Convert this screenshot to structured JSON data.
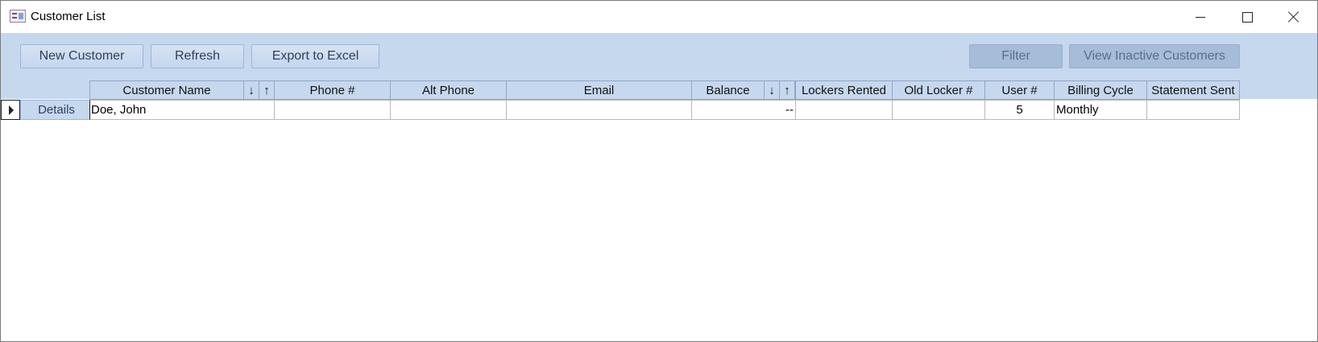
{
  "window": {
    "title": "Customer List",
    "icon": "form-icon"
  },
  "toolbar": {
    "new_customer": "New Customer",
    "refresh": "Refresh",
    "export_excel": "Export to Excel",
    "filter": "Filter",
    "view_inactive": "View Inactive Customers"
  },
  "table": {
    "headers": {
      "customer_name": "Customer Name",
      "phone": "Phone #",
      "alt_phone": "Alt Phone",
      "email": "Email",
      "balance": "Balance",
      "lockers_rented": "Lockers Rented",
      "old_locker": "Old Locker #",
      "user": "User #",
      "billing_cycle": "Billing Cycle",
      "statement_sent": "Statement Sent"
    },
    "sort_desc": "↓",
    "sort_asc": "↑",
    "rows": [
      {
        "details": "Details",
        "customer_name": "Doe, John",
        "phone": "",
        "alt_phone": "",
        "email": "",
        "balance": "--",
        "lockers_rented": "",
        "old_locker": "",
        "user": "5",
        "billing_cycle": "Monthly",
        "statement_sent": ""
      }
    ]
  }
}
